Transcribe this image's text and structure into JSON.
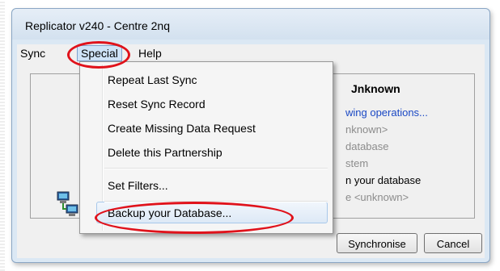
{
  "window": {
    "title": "Replicator v240 - Centre 2nq"
  },
  "menubar": {
    "sync": "Sync",
    "special": "Special",
    "help": "Help"
  },
  "special_menu": {
    "items": [
      "Repeat Last Sync",
      "Reset Sync Record",
      "Create Missing Data Request",
      "Delete this Partnership",
      "Set Filters...",
      "Backup your Database..."
    ],
    "highlighted_item": "Backup your Database..."
  },
  "status_panel": {
    "header": "Jnknown",
    "lines": [
      "wing operations...",
      "nknown>",
      "database",
      "stem",
      "n your database",
      "e <unknown>"
    ]
  },
  "buttons": {
    "synchronise": "Synchronise",
    "cancel": "Cancel"
  },
  "colors": {
    "annotation": "#e0121b",
    "link_blue": "#1a48c4",
    "menu_highlight": "#cfe3f7"
  },
  "icons": [
    "network-computers-icon"
  ]
}
